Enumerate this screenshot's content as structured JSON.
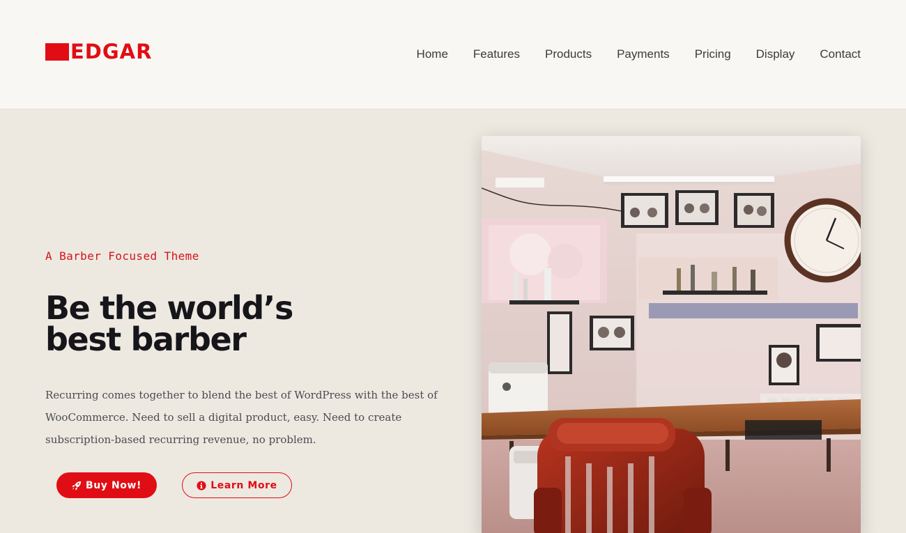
{
  "brand": {
    "name": "EDGAR",
    "accent": "#e10d15"
  },
  "nav": {
    "items": [
      "Home",
      "Features",
      "Products",
      "Payments",
      "Pricing",
      "Display",
      "Contact"
    ]
  },
  "hero": {
    "kicker": "A Barber Focused Theme",
    "headline_line1": "Be the world’s",
    "headline_line2": "best barber",
    "description": "Recurring comes together to blend the best of WordPress with the best of WooCommerce. Need to sell a digital product, easy. Need to create subscription-based recurring revenue, no problem.",
    "buttons": {
      "buy": {
        "label": "Buy Now!",
        "icon": "rocket-icon"
      },
      "learn": {
        "label": "Learn More",
        "icon": "info-icon"
      }
    }
  },
  "photo": {
    "subject": "barbershop-interior-with-red-barber-chair"
  }
}
